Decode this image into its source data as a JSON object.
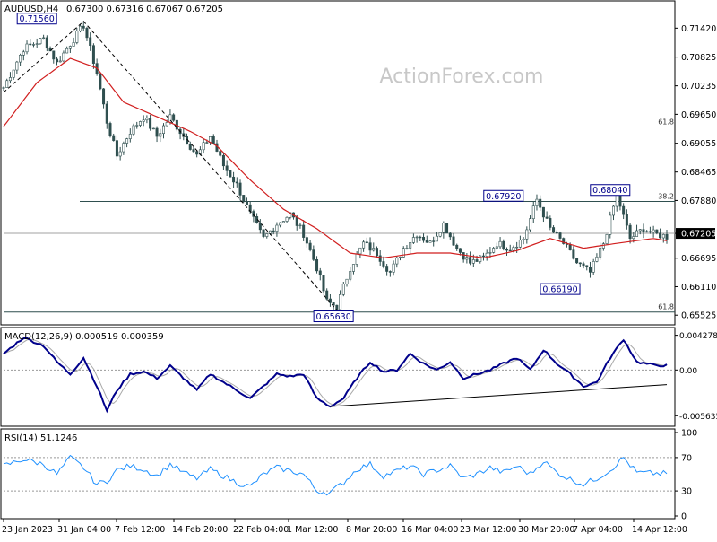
{
  "watermark": "ActionForex.com",
  "colors": {
    "candle": "#2f4f4f",
    "ma": "#d11f1f",
    "macd": "#00008b",
    "macd_signal": "#a9a9a9",
    "rsi": "#1e90ff",
    "level_line": "#2f4f4f",
    "price_line": "#a0a0a0",
    "trend_dashed": "#000000",
    "label_border": "#00008b",
    "label_text": "#00008b"
  },
  "chart_data": [
    {
      "type": "candlestick",
      "panel": "price",
      "title": "AUDUSD,H4",
      "ohlc_header": [
        "0.67300",
        "0.67316",
        "0.67067",
        "0.67205"
      ],
      "current_price": "0.67205",
      "ylim": [
        0.654,
        0.7185
      ],
      "y_ticks": [
        "0.71420",
        "0.70825",
        "0.70235",
        "0.69650",
        "0.69055",
        "0.68465",
        "0.67880",
        "0.67205",
        "0.66695",
        "0.66110",
        "0.65525"
      ],
      "fib_levels": [
        {
          "label": "61.8",
          "value": 0.6939
        },
        {
          "label": "38.2",
          "value": 0.6786
        },
        {
          "label": "61.8",
          "value": 0.6559
        }
      ],
      "annotations": [
        {
          "text": "0.71560",
          "value": 0.7156
        },
        {
          "text": "0.65630",
          "value": 0.6563
        },
        {
          "text": "0.67920",
          "value": 0.6792
        },
        {
          "text": "0.68040",
          "value": 0.6804
        },
        {
          "text": "0.66190",
          "value": 0.6619
        }
      ],
      "trend_anchor_prices": [
        0.701,
        0.7156,
        0.6563
      ],
      "close_anchors": [
        [
          0,
          0.702
        ],
        [
          6,
          0.71
        ],
        [
          12,
          0.712
        ],
        [
          16,
          0.707
        ],
        [
          20,
          0.711
        ],
        [
          24,
          0.7148
        ],
        [
          28,
          0.705
        ],
        [
          31,
          0.695
        ],
        [
          34,
          0.688
        ],
        [
          38,
          0.693
        ],
        [
          42,
          0.696
        ],
        [
          46,
          0.692
        ],
        [
          50,
          0.696
        ],
        [
          54,
          0.692
        ],
        [
          58,
          0.688
        ],
        [
          62,
          0.692
        ],
        [
          66,
          0.686
        ],
        [
          70,
          0.682
        ],
        [
          74,
          0.676
        ],
        [
          78,
          0.671
        ],
        [
          82,
          0.674
        ],
        [
          86,
          0.676
        ],
        [
          90,
          0.672
        ],
        [
          94,
          0.665
        ],
        [
          97,
          0.658
        ],
        [
          100,
          0.657
        ],
        [
          104,
          0.665
        ],
        [
          108,
          0.67
        ],
        [
          112,
          0.668
        ],
        [
          116,
          0.664
        ],
        [
          120,
          0.669
        ],
        [
          124,
          0.672
        ],
        [
          128,
          0.67
        ],
        [
          132,
          0.674
        ],
        [
          136,
          0.669
        ],
        [
          140,
          0.666
        ],
        [
          144,
          0.667
        ],
        [
          148,
          0.67
        ],
        [
          152,
          0.669
        ],
        [
          156,
          0.671
        ],
        [
          160,
          0.679
        ],
        [
          164,
          0.673
        ],
        [
          168,
          0.67
        ],
        [
          172,
          0.666
        ],
        [
          176,
          0.664
        ],
        [
          180,
          0.67
        ],
        [
          184,
          0.68
        ],
        [
          188,
          0.671
        ],
        [
          192,
          0.673
        ],
        [
          195,
          0.672
        ]
      ],
      "ma_anchors": [
        [
          0,
          0.694
        ],
        [
          10,
          0.703
        ],
        [
          20,
          0.708
        ],
        [
          28,
          0.706
        ],
        [
          36,
          0.699
        ],
        [
          46,
          0.696
        ],
        [
          56,
          0.693
        ],
        [
          64,
          0.69
        ],
        [
          74,
          0.683
        ],
        [
          84,
          0.677
        ],
        [
          94,
          0.673
        ],
        [
          104,
          0.668
        ],
        [
          114,
          0.667
        ],
        [
          124,
          0.668
        ],
        [
          134,
          0.668
        ],
        [
          144,
          0.667
        ],
        [
          154,
          0.6685
        ],
        [
          164,
          0.671
        ],
        [
          174,
          0.669
        ],
        [
          184,
          0.67
        ],
        [
          195,
          0.671
        ]
      ]
    },
    {
      "type": "line",
      "panel": "macd",
      "title": "MACD(12,26,9) 0.000519 0.000359",
      "y_ticks": [
        "0.004278",
        "0.00",
        "-0.005635"
      ],
      "ylim": [
        -0.0066,
        0.0049
      ],
      "macd_anchors": [
        [
          0,
          0.002
        ],
        [
          6,
          0.004
        ],
        [
          12,
          0.003
        ],
        [
          16,
          0.001
        ],
        [
          20,
          -0.0005
        ],
        [
          24,
          0.0015
        ],
        [
          28,
          -0.002
        ],
        [
          31,
          -0.005
        ],
        [
          34,
          -0.0025
        ],
        [
          38,
          -0.0005
        ],
        [
          42,
          -0.0002
        ],
        [
          46,
          -0.001
        ],
        [
          50,
          0.0005
        ],
        [
          54,
          -0.001
        ],
        [
          58,
          -0.0025
        ],
        [
          62,
          -0.0005
        ],
        [
          66,
          -0.0015
        ],
        [
          70,
          -0.0025
        ],
        [
          74,
          -0.0035
        ],
        [
          78,
          -0.002
        ],
        [
          82,
          -0.0005
        ],
        [
          86,
          -0.0008
        ],
        [
          90,
          -0.0005
        ],
        [
          94,
          -0.0035
        ],
        [
          98,
          -0.0045
        ],
        [
          102,
          -0.0035
        ],
        [
          106,
          -0.001
        ],
        [
          110,
          0.001
        ],
        [
          114,
          -0.0002
        ],
        [
          118,
          0.0
        ],
        [
          122,
          0.002
        ],
        [
          126,
          0.0008
        ],
        [
          130,
          0.0
        ],
        [
          134,
          0.001
        ],
        [
          138,
          -0.001
        ],
        [
          142,
          -0.0005
        ],
        [
          146,
          0.0
        ],
        [
          150,
          0.0008
        ],
        [
          154,
          0.0015
        ],
        [
          158,
          0.0
        ],
        [
          162,
          0.0025
        ],
        [
          166,
          0.0008
        ],
        [
          170,
          -0.0005
        ],
        [
          174,
          -0.002
        ],
        [
          178,
          -0.0015
        ],
        [
          182,
          0.0015
        ],
        [
          186,
          0.0038
        ],
        [
          190,
          0.001
        ],
        [
          195,
          0.0006
        ]
      ],
      "signal_lag": 3,
      "trend_line": [
        [
          98,
          -0.0045
        ],
        [
          199,
          -0.0018
        ]
      ]
    },
    {
      "type": "line",
      "panel": "rsi",
      "title": "RSI(14) 51.1246",
      "y_ticks": [
        "100",
        "70",
        "30",
        "0"
      ],
      "ylim": [
        0,
        100
      ],
      "levels": [
        70,
        30
      ],
      "rsi_anchors": [
        [
          0,
          60
        ],
        [
          6,
          68
        ],
        [
          12,
          62
        ],
        [
          16,
          50
        ],
        [
          20,
          70
        ],
        [
          24,
          58
        ],
        [
          28,
          38
        ],
        [
          31,
          42
        ],
        [
          34,
          55
        ],
        [
          38,
          60
        ],
        [
          42,
          56
        ],
        [
          46,
          48
        ],
        [
          50,
          62
        ],
        [
          54,
          52
        ],
        [
          58,
          45
        ],
        [
          62,
          56
        ],
        [
          66,
          48
        ],
        [
          70,
          40
        ],
        [
          74,
          35
        ],
        [
          78,
          50
        ],
        [
          82,
          58
        ],
        [
          86,
          54
        ],
        [
          90,
          50
        ],
        [
          94,
          30
        ],
        [
          98,
          28
        ],
        [
          102,
          40
        ],
        [
          106,
          56
        ],
        [
          110,
          62
        ],
        [
          114,
          48
        ],
        [
          118,
          54
        ],
        [
          122,
          60
        ],
        [
          126,
          50
        ],
        [
          130,
          55
        ],
        [
          134,
          60
        ],
        [
          138,
          45
        ],
        [
          142,
          50
        ],
        [
          146,
          58
        ],
        [
          150,
          52
        ],
        [
          154,
          60
        ],
        [
          158,
          50
        ],
        [
          162,
          66
        ],
        [
          166,
          52
        ],
        [
          170,
          44
        ],
        [
          174,
          38
        ],
        [
          178,
          45
        ],
        [
          182,
          55
        ],
        [
          186,
          70
        ],
        [
          190,
          52
        ],
        [
          195,
          51
        ]
      ]
    }
  ],
  "x_axis": {
    "total_bars": 200,
    "labels": [
      {
        "text": "23 Jan 2023",
        "bar": 0
      },
      {
        "text": "31 Jan 04:00",
        "bar": 22
      },
      {
        "text": "7 Feb 12:00",
        "bar": 44
      },
      {
        "text": "14 Feb 20:00",
        "bar": 66
      },
      {
        "text": "22 Feb 04:00",
        "bar": 89
      },
      {
        "text": "1 Mar 12:00",
        "bar": 112
      },
      {
        "text": "8 Mar 20:00",
        "bar": 134
      },
      {
        "text": "16 Mar 04:00",
        "bar": 156
      },
      {
        "text": "23 Mar 12:00",
        "bar": 178
      },
      {
        "text": "30 Mar 20:00",
        "bar": 199
      },
      {
        "text": "7 Apr 04:00",
        "bar": 222
      },
      {
        "text": "14 Apr 12:00",
        "bar": 244
      }
    ]
  }
}
